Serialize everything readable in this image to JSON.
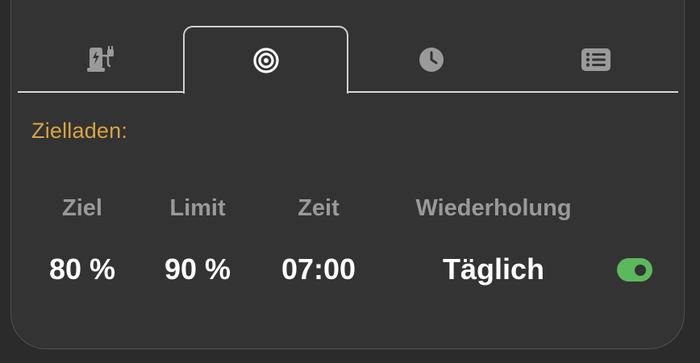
{
  "tabs": [
    {
      "icon": "ev-charger-icon",
      "active": false
    },
    {
      "icon": "target-icon",
      "active": true
    },
    {
      "icon": "clock-icon",
      "active": false
    },
    {
      "icon": "list-icon",
      "active": false
    }
  ],
  "section": {
    "heading": "Zielladen:"
  },
  "plan": {
    "labels": {
      "target": "Ziel",
      "limit": "Limit",
      "time": "Zeit",
      "repeat": "Wiederholung"
    },
    "values": {
      "target": "80 %",
      "limit": "90 %",
      "time": "07:00",
      "repeat": "Täglich"
    },
    "enabled": true
  },
  "colors": {
    "accent": "#d9a441",
    "toggle_on": "#5cb85c",
    "label": "#999999",
    "icon_inactive": "#9a9a9a"
  }
}
